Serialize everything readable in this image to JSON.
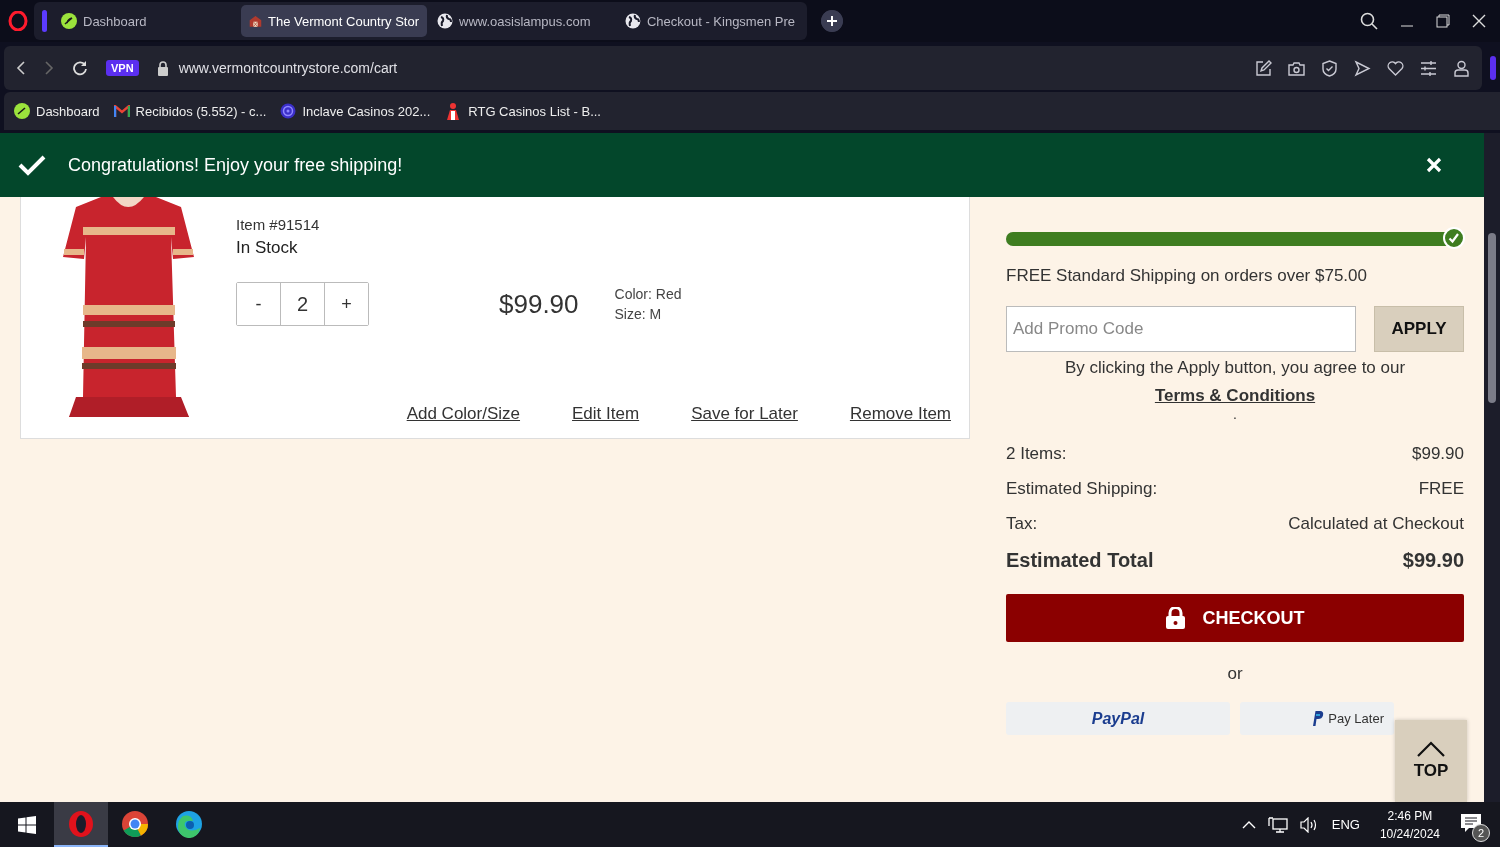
{
  "tabs": [
    {
      "label": "Dashboard",
      "selected": false
    },
    {
      "label": "The Vermont Country Stor",
      "selected": true
    },
    {
      "label": "www.oasislampus.com",
      "selected": false
    },
    {
      "label": "Checkout - Kingsmen Pre",
      "selected": false
    }
  ],
  "address_bar": {
    "vpn_badge": "VPN",
    "url": "www.vermontcountrystore.com/cart"
  },
  "bookmarks": [
    "Dashboard",
    "Recibidos (5.552) - c...",
    "Inclave Casinos 202...",
    "RTG Casinos List - B..."
  ],
  "banner": {
    "message": "Congratulations! Enjoy your free shipping!"
  },
  "cart_item": {
    "item_number": "Item #91514",
    "stock": "In Stock",
    "quantity": {
      "decrement": "-",
      "value": "2",
      "increment": "+"
    },
    "price": "$99.90",
    "color_option": "Color: Red",
    "size_option": "Size: M",
    "actions": [
      "Add Color/Size",
      "Edit Item",
      "Save for Later",
      "Remove Item"
    ]
  },
  "summary": {
    "shipping_progress": {
      "level": 1
    },
    "free_shipping_note": "FREE Standard Shipping on orders over $75.00",
    "promo": {
      "placeholder": "Add Promo Code",
      "button": "APPLY"
    },
    "terms_text": "By clicking the Apply button, you agree to our",
    "terms_link": "Terms & Conditions",
    "dot": ".",
    "lines": [
      {
        "label": "2 Items:",
        "value": "$99.90",
        "kind": "normal"
      },
      {
        "label": "Estimated Shipping:",
        "value": "FREE",
        "kind": "normal"
      },
      {
        "label": "Tax:",
        "value": "Calculated at Checkout",
        "kind": "normal"
      },
      {
        "label": "Estimated Total",
        "value": "$99.90",
        "kind": "total"
      }
    ],
    "checkout": "CHECKOUT",
    "or": "or",
    "paypal": "PayPal",
    "pay_later": "Pay Later"
  },
  "top_button": "TOP",
  "taskbar": {
    "apps": [
      {
        "kind": "opera",
        "selected": true
      },
      {
        "kind": "chrome",
        "selected": false
      },
      {
        "kind": "edge",
        "selected": false
      }
    ],
    "language": "ENG",
    "time": "2:46 PM",
    "date": "10/24/2024",
    "notifications": "2"
  }
}
